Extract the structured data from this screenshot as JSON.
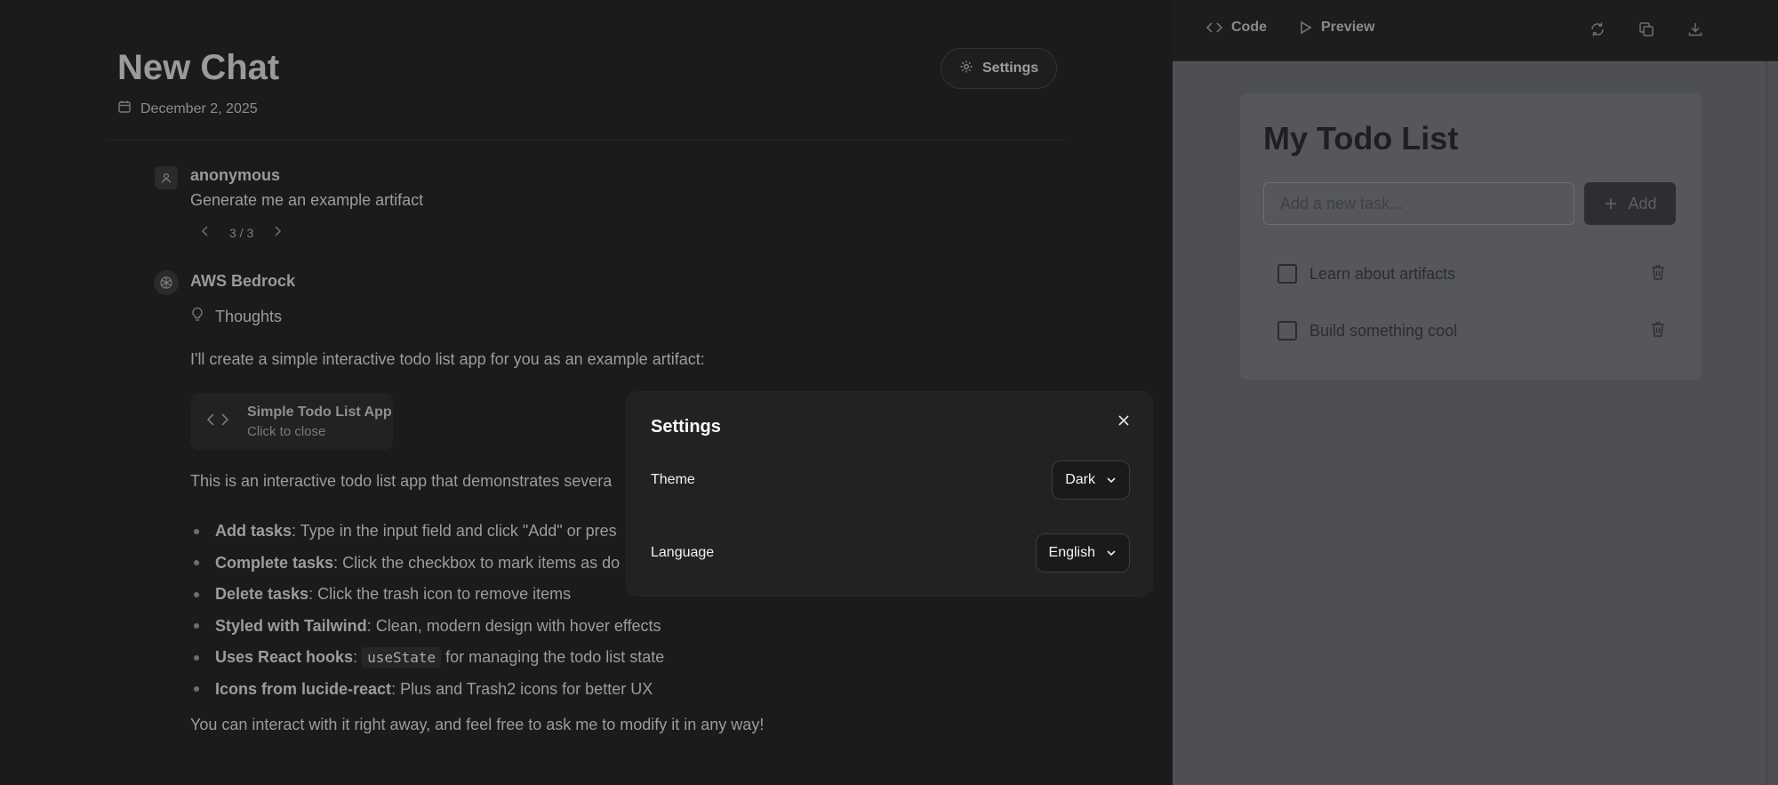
{
  "chat": {
    "title": "New Chat",
    "date": "December 2, 2025",
    "settings_label": "Settings"
  },
  "user_message": {
    "sender": "anonymous",
    "text": "Generate me an example artifact",
    "pager": "3 / 3"
  },
  "assistant_message": {
    "sender": "AWS Bedrock",
    "thoughts_label": "Thoughts",
    "intro": "I'll create a simple interactive todo list app for you as an example artifact:",
    "artifact": {
      "title": "Simple Todo List App",
      "subtitle": "Click to close"
    },
    "description": "This is an interactive todo list app that demonstrates severa",
    "features": [
      {
        "bold": "Add tasks",
        "rest": ": Type in the input field and click \"Add\" or pres"
      },
      {
        "bold": "Complete tasks",
        "rest": ": Click the checkbox to mark items as do"
      },
      {
        "bold": "Delete tasks",
        "rest": ": Click the trash icon to remove items"
      },
      {
        "bold": "Styled with Tailwind",
        "rest": ": Clean, modern design with hover effects"
      },
      {
        "bold": "Uses React hooks",
        "rest_pre": ": ",
        "code": "useState",
        "rest": " for managing the todo list state"
      },
      {
        "bold": "Icons from lucide-react",
        "rest": ": Plus and Trash2 icons for better UX"
      }
    ],
    "closing": "You can interact with it right away, and feel free to ask me to modify it in any way!"
  },
  "artifact_panel": {
    "tabs": {
      "code": "Code",
      "preview": "Preview"
    },
    "todo": {
      "title": "My Todo List",
      "input_placeholder": "Add a new task...",
      "add_label": "Add",
      "items": [
        "Learn about artifacts",
        "Build something cool"
      ]
    }
  },
  "settings_modal": {
    "title": "Settings",
    "theme_label": "Theme",
    "theme_value": "Dark",
    "language_label": "Language",
    "language_value": "English"
  },
  "colors": {
    "overlay_dark": "#1b1b1b",
    "modal_bg": "#222222",
    "preview_bg": "#4d4f55"
  }
}
